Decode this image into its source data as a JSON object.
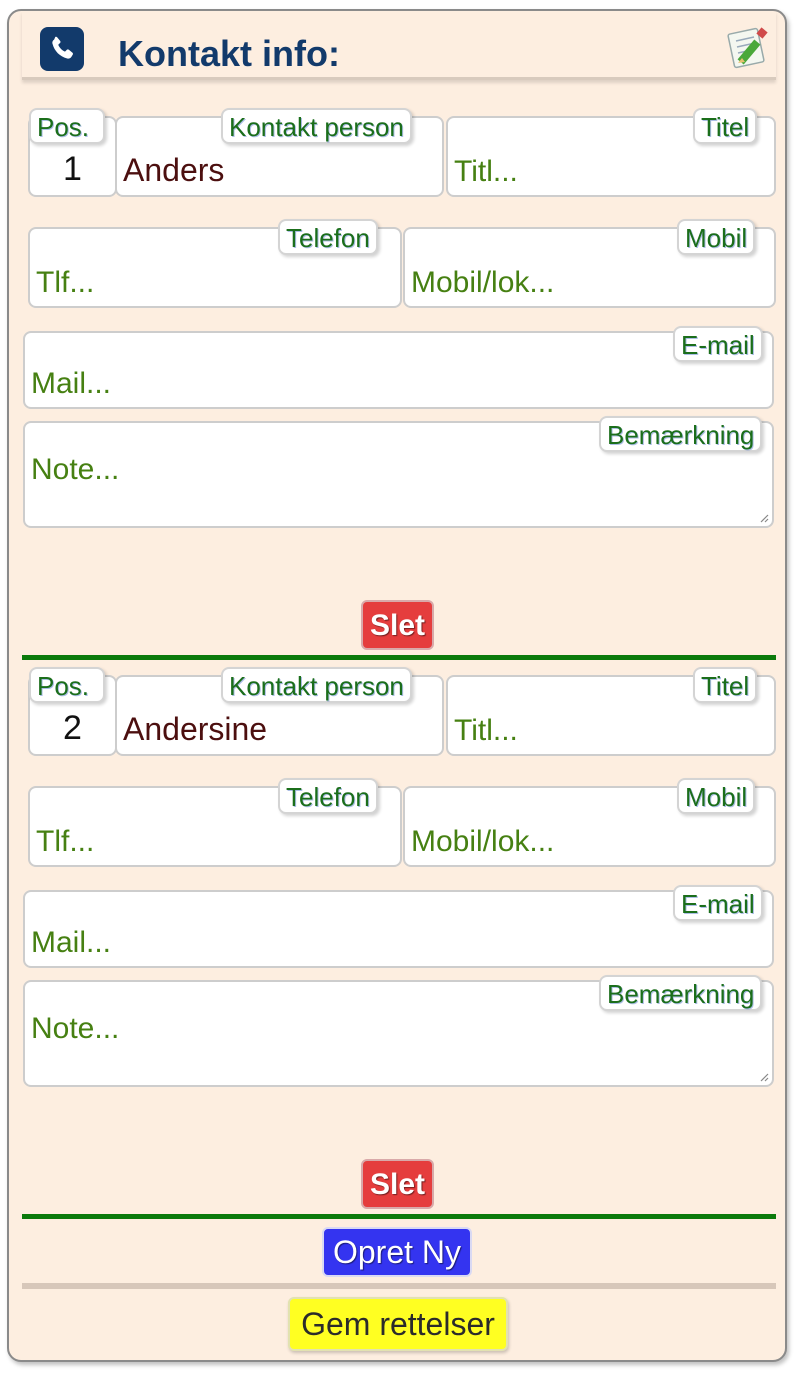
{
  "header": {
    "title": "Kontakt info:",
    "phone_icon": "phone-icon",
    "edit_icon": "edit-pencil-icon",
    "accent": "#123a6b"
  },
  "labels": {
    "pos": "Pos.",
    "contact": "Kontakt person",
    "title": "Titel",
    "phone": "Telefon",
    "mobile": "Mobil",
    "email": "E-mail",
    "note": "Bemærkning"
  },
  "placeholders": {
    "title": "Titl...",
    "phone": "Tlf...",
    "mobile": "Mobil/lok...",
    "email": "Mail...",
    "note": "Note..."
  },
  "contacts": [
    {
      "pos": "1",
      "name": "Anders",
      "delete_label": "Slet"
    },
    {
      "pos": "2",
      "name": "Andersine",
      "delete_label": "Slet"
    }
  ],
  "actions": {
    "create_label": "Opret Ny",
    "save_label": "Gem rettelser"
  },
  "colors": {
    "delete": "#e53d3d",
    "create": "#3434f0",
    "save": "#ffff22",
    "divider": "#0b7a0b",
    "label_text": "#1b6e1b",
    "placeholder": "#468012",
    "value_text": "#4c0f0f"
  }
}
